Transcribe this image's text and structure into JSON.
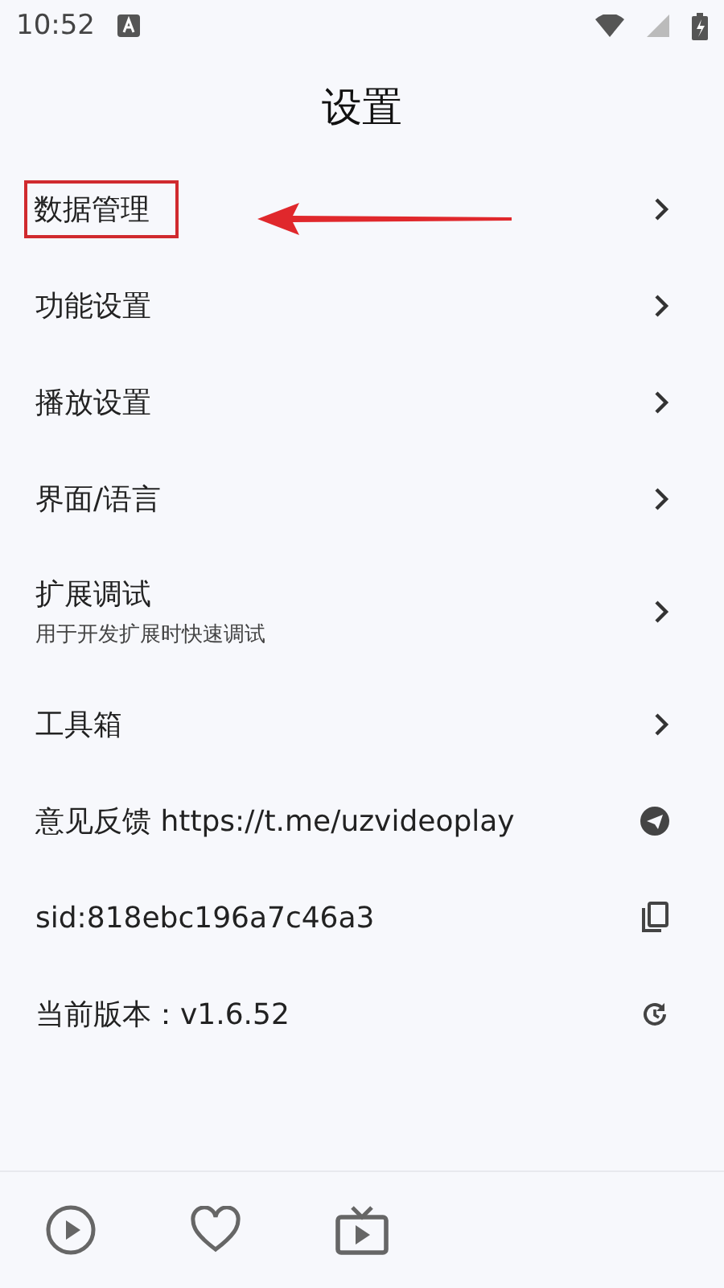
{
  "status_bar": {
    "time": "10:52"
  },
  "title": "设置",
  "items": [
    {
      "label": "数据管理",
      "kind": "chevron",
      "highlighted": true
    },
    {
      "label": "功能设置",
      "kind": "chevron",
      "highlighted": false
    },
    {
      "label": "播放设置",
      "kind": "chevron",
      "highlighted": false
    },
    {
      "label": "界面/语言",
      "kind": "chevron",
      "highlighted": false
    },
    {
      "label": "扩展调试",
      "subtitle": "用于开发扩展时快速调试",
      "kind": "chevron",
      "highlighted": false
    },
    {
      "label": "工具箱",
      "kind": "chevron",
      "highlighted": false
    },
    {
      "label": "意见反馈 https://t.me/uzvideoplay",
      "kind": "send",
      "highlighted": false
    },
    {
      "label": "sid:818ebc196a7c46a3",
      "kind": "copy",
      "highlighted": false
    },
    {
      "label": "当前版本：v1.6.52",
      "kind": "update",
      "highlighted": false
    }
  ],
  "bottom_nav": [
    {
      "kind": "play"
    },
    {
      "kind": "heart"
    },
    {
      "kind": "tv"
    }
  ]
}
